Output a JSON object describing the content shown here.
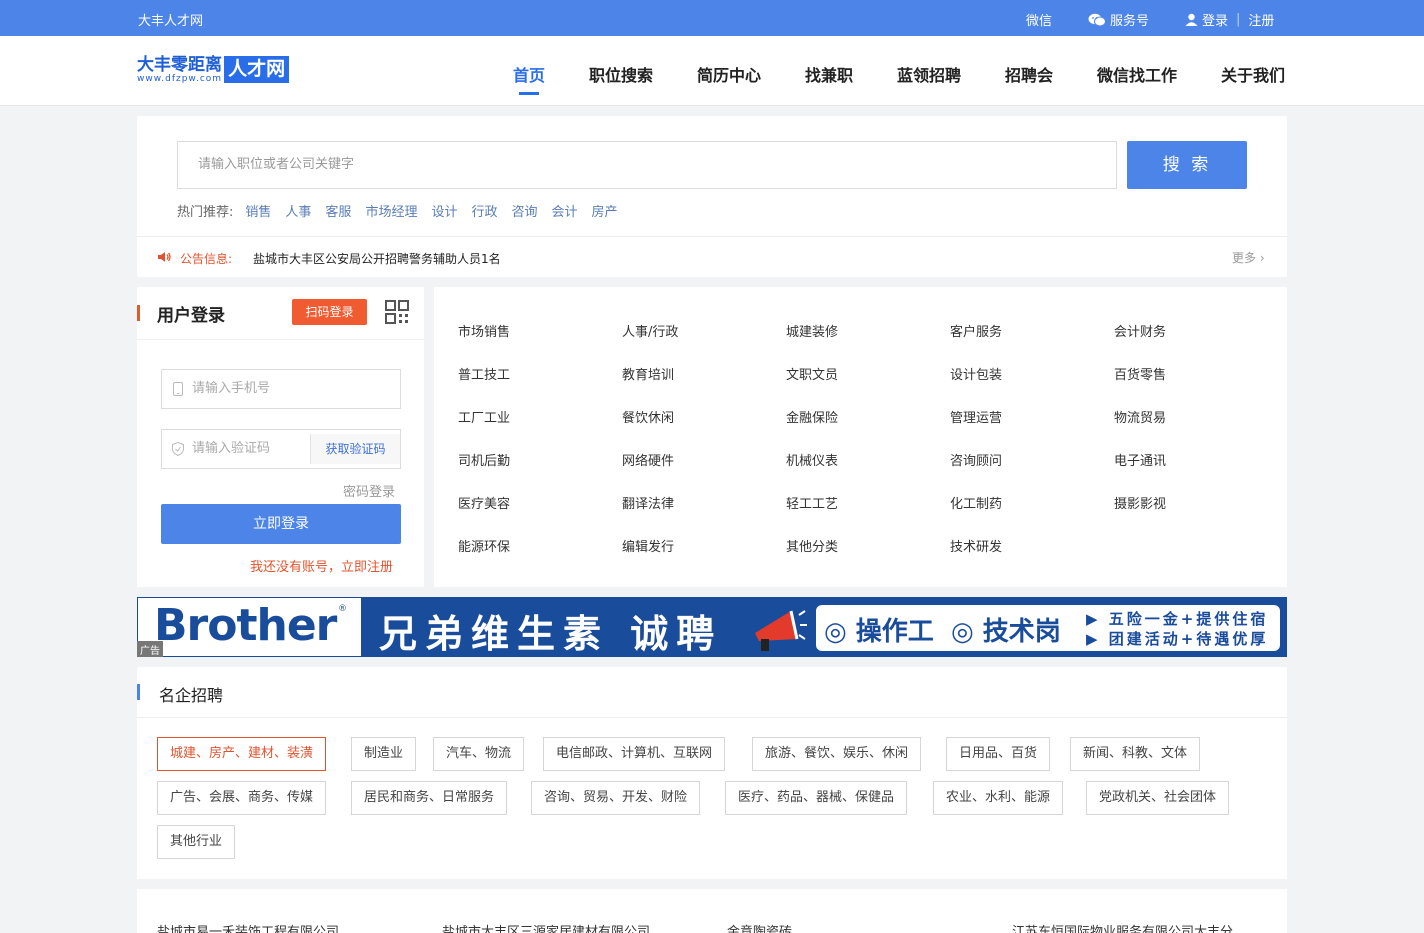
{
  "topbar": {
    "site_name": "大丰人才网",
    "wechat": "微信",
    "service": "服务号",
    "login": "登录",
    "register": "注册"
  },
  "header": {
    "logo_cn": "大丰零距离",
    "logo_box": "人才网",
    "logo_url": "www.dfzpw.com",
    "nav": [
      "首页",
      "职位搜索",
      "简历中心",
      "找兼职",
      "蓝领招聘",
      "招聘会",
      "微信找工作",
      "关于我们"
    ]
  },
  "search": {
    "placeholder": "请输入职位或者公司关键字",
    "button": "搜 索",
    "hot_label": "热门推荐:",
    "hot_keywords": [
      "销售",
      "人事",
      "客服",
      "市场经理",
      "设计",
      "行政",
      "咨询",
      "会计",
      "房产"
    ]
  },
  "notice": {
    "label": "公告信息:",
    "text": "盐城市大丰区公安局公开招聘警务辅助人员1名",
    "more": "更多 ›"
  },
  "login": {
    "title": "用户登录",
    "qr_button": "扫码登录",
    "phone_placeholder": "请输入手机号",
    "code_placeholder": "请输入验证码",
    "get_code": "获取验证码",
    "password_login": "密码登录",
    "submit": "立即登录",
    "register_link": "我还没有账号，立即注册"
  },
  "categories": [
    [
      "市场销售",
      "人事/行政",
      "城建装修",
      "客户服务",
      "会计财务"
    ],
    [
      "普工技工",
      "教育培训",
      "文职文员",
      "设计包装",
      "百货零售"
    ],
    [
      "工厂工业",
      "餐饮休闲",
      "金融保险",
      "管理运营",
      "物流贸易"
    ],
    [
      "司机后勤",
      "网络硬件",
      "机械仪表",
      "咨询顾问",
      "电子通讯"
    ],
    [
      "医疗美容",
      "翻译法律",
      "轻工工艺",
      "化工制药",
      "摄影影视"
    ],
    [
      "能源环保",
      "编辑发行",
      "其他分类",
      "技术研发"
    ]
  ],
  "banner": {
    "brand": "Brother",
    "registered": "®",
    "ad_label": "广告",
    "slogan": "兄弟维生素 诚聘",
    "job1": "操作工",
    "job2": "技术岗",
    "benefit1": "五险一金+提供住宿",
    "benefit2": "团建活动+待遇优厚",
    "color_primary": "#1a4c9c"
  },
  "famous": {
    "title": "名企招聘",
    "tags": [
      "城建、房产、建材、装潢",
      "制造业",
      "汽车、物流",
      "电信邮政、计算机、互联网",
      "旅游、餐饮、娱乐、休闲",
      "日用品、百货",
      "新闻、科教、文体",
      "广告、会展、商务、传媒",
      "居民和商务、日常服务",
      "咨询、贸易、开发、财险",
      "医疗、药品、器械、保健品",
      "农业、水利、能源",
      "党政机关、社会团体",
      "其他行业"
    ],
    "active_index": 0
  },
  "companies": [
    "盐城市易一禾装饰工程有限公司",
    "盐城市大丰区三源家居建材有限公司",
    "金意陶瓷砖",
    "江苏东恒国际物业服务有限公司大丰分"
  ],
  "colors": {
    "accent": "#4d84e8",
    "orange": "#e0552f"
  }
}
